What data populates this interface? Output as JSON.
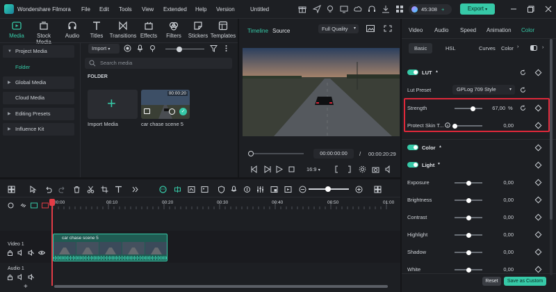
{
  "titlebar": {
    "app_name": "Wondershare Filmora",
    "menus": [
      "File",
      "Edit",
      "Tools",
      "View",
      "Extended",
      "Help",
      "Version"
    ],
    "project": "Untitled",
    "credits": "45:308",
    "export_label": "Export"
  },
  "media": {
    "tabs": [
      "Media",
      "Stock Media",
      "Audio",
      "Titles",
      "Transitions",
      "Effects",
      "Filters",
      "Stickers",
      "Templates"
    ],
    "sidebar": [
      "Project Media",
      "Folder",
      "Global Media",
      "Cloud Media",
      "Editing Presets",
      "Influence Kit"
    ],
    "import_label": "Import",
    "search_placeholder": "Search media",
    "folder_label": "FOLDER",
    "import_tile_label": "Import Media",
    "clip_label": "car chase scene 5",
    "clip_duration": "00:00:20"
  },
  "player": {
    "tabs": [
      "Timeline",
      "Source"
    ],
    "quality": "Full Quality",
    "current_time": "00:00:00:00",
    "separator": "/",
    "total_time": "00:00:20:29",
    "aspect": "16:9",
    "progress": 0
  },
  "inspector": {
    "tabs": [
      "Video",
      "Audio",
      "Speed",
      "Animation",
      "Color"
    ],
    "subtabs": [
      "Basic",
      "HSL",
      "Curves",
      "Color"
    ],
    "lut": {
      "label": "LUT",
      "preset_label": "Lut Preset",
      "preset_value": "GPLog 709 Style"
    },
    "strength": {
      "label": "Strength",
      "value": "67,00",
      "unit": "%",
      "level": 0.67
    },
    "protect_skin": {
      "label": "Protect Skin T...",
      "value": "0,00",
      "level": 0.0
    },
    "color_label": "Color",
    "light_label": "Light",
    "light_rows": [
      {
        "label": "Exposure",
        "value": "0,00"
      },
      {
        "label": "Brightness",
        "value": "0,00"
      },
      {
        "label": "Contrast",
        "value": "0,00"
      },
      {
        "label": "Highlight",
        "value": "0,00"
      },
      {
        "label": "Shadow",
        "value": "0,00"
      },
      {
        "label": "White",
        "value": "0,00"
      }
    ],
    "reset_label": "Reset",
    "save_custom_label": "Save as Custom"
  },
  "timeline": {
    "ruler_labels": [
      "00:00",
      "00:10",
      "00:20",
      "00:30",
      "00:40",
      "00:50",
      "01:00"
    ],
    "video_track_label": "Video 1",
    "audio_track_label": "Audio 1",
    "clip_name": "car chase scene 5"
  },
  "colors": {
    "accent": "#36c9a7",
    "highlight": "#e0283a",
    "playhead": "#e33c46"
  }
}
